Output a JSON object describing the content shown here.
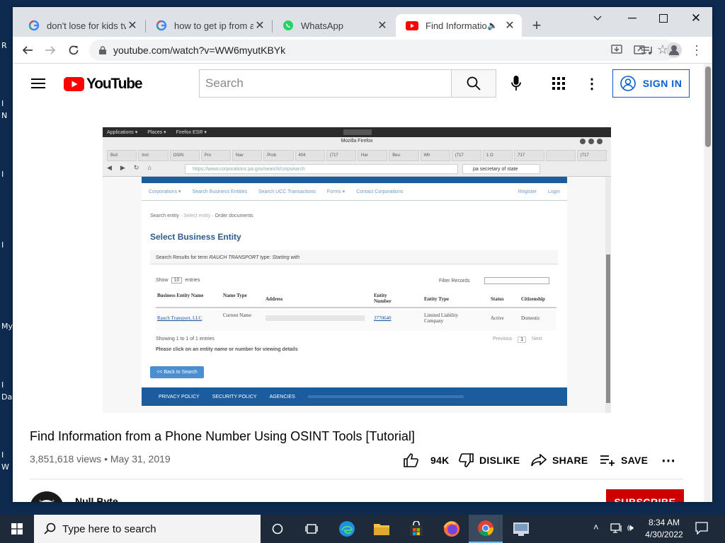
{
  "desktop": {
    "labels": [
      "R",
      "I",
      "N",
      "I",
      "I",
      "My",
      "I",
      "Da",
      "I",
      "W"
    ]
  },
  "browser": {
    "tabs": [
      {
        "title": "don't lose for kids tv",
        "icon": "google-g-icon"
      },
      {
        "title": "how to get ip from an",
        "icon": "google-g-icon"
      },
      {
        "title": "WhatsApp",
        "icon": "whatsapp-icon"
      },
      {
        "title": "Find Information",
        "icon": "youtube-icon"
      }
    ],
    "url": "youtube.com/watch?v=WW6myutKBYk"
  },
  "youtube": {
    "logo_text": "YouTube",
    "search_placeholder": "Search",
    "signin_label": "SIGN IN"
  },
  "video_frame": {
    "topbar": [
      "Applications ▾",
      "Places ▾",
      "Firefox ESR ▾"
    ],
    "window_title": "Mozilla Firefox",
    "tabs": [
      "Buil",
      "Inst",
      "OSIN",
      "Pro",
      "Nav",
      "Prob",
      "404",
      "(717",
      "Har",
      "Beu",
      "Wh",
      "(717",
      "1 O",
      "717",
      "",
      "(717"
    ],
    "url": "https://www.corporations.pa.gov/search/corpsearch",
    "search": "pa secretary of state",
    "nav": [
      "Corporations ▾",
      "Search Business Entities",
      "Search UCC Transactions",
      "Forms ▾",
      "Contact Corporations"
    ],
    "nav_right": [
      "Register",
      "Login"
    ],
    "breadcrumb": [
      "Search entity",
      "Select entity",
      "Order documents"
    ],
    "heading": "Select Business Entity",
    "results_prefix": "Search Results for term",
    "results_term": "RAUCH TRANSPORT",
    "results_type_label": "type:",
    "results_type": "Starting with",
    "show_label": "Show",
    "show_value": "10",
    "entries_label": "entries",
    "filter_label": "Filter Records",
    "columns": [
      "Business Entity Name",
      "Name Type",
      "Address",
      "Entity Number",
      "Entity Type",
      "Status",
      "Citizenship"
    ],
    "row": {
      "name": "Rauch Transport, LLC",
      "name_type": "Current Name",
      "number": "3770640",
      "entity_type": "Limited Liability Company",
      "status": "Active",
      "citizenship": "Domestic"
    },
    "showing": "Showing 1 to 1 of 1 entries",
    "pager": [
      "Previous",
      "1",
      "Next"
    ],
    "hint": "Please click on an entity name or number for viewing details",
    "back_button": "<< Back to Search",
    "footer": [
      "PRIVACY POLICY",
      "SECURITY POLICY",
      "AGENCIES"
    ]
  },
  "video_info": {
    "title": "Find Information from a Phone Number Using OSINT Tools [Tutorial]",
    "views_line": "3,851,618 views • May 31, 2019",
    "like_count": "94K",
    "dislike_label": "DISLIKE",
    "share_label": "SHARE",
    "save_label": "SAVE",
    "channel": "Null Byte",
    "subscribe_label": "SUBSCRIBE"
  },
  "taskbar": {
    "search_placeholder": "Type here to search",
    "time": "8:34 AM",
    "date": "4/30/2022"
  },
  "colors": {
    "youtube_red": "#ff0000",
    "signin_blue": "#065fd4",
    "subscribe_red": "#cc0000"
  }
}
